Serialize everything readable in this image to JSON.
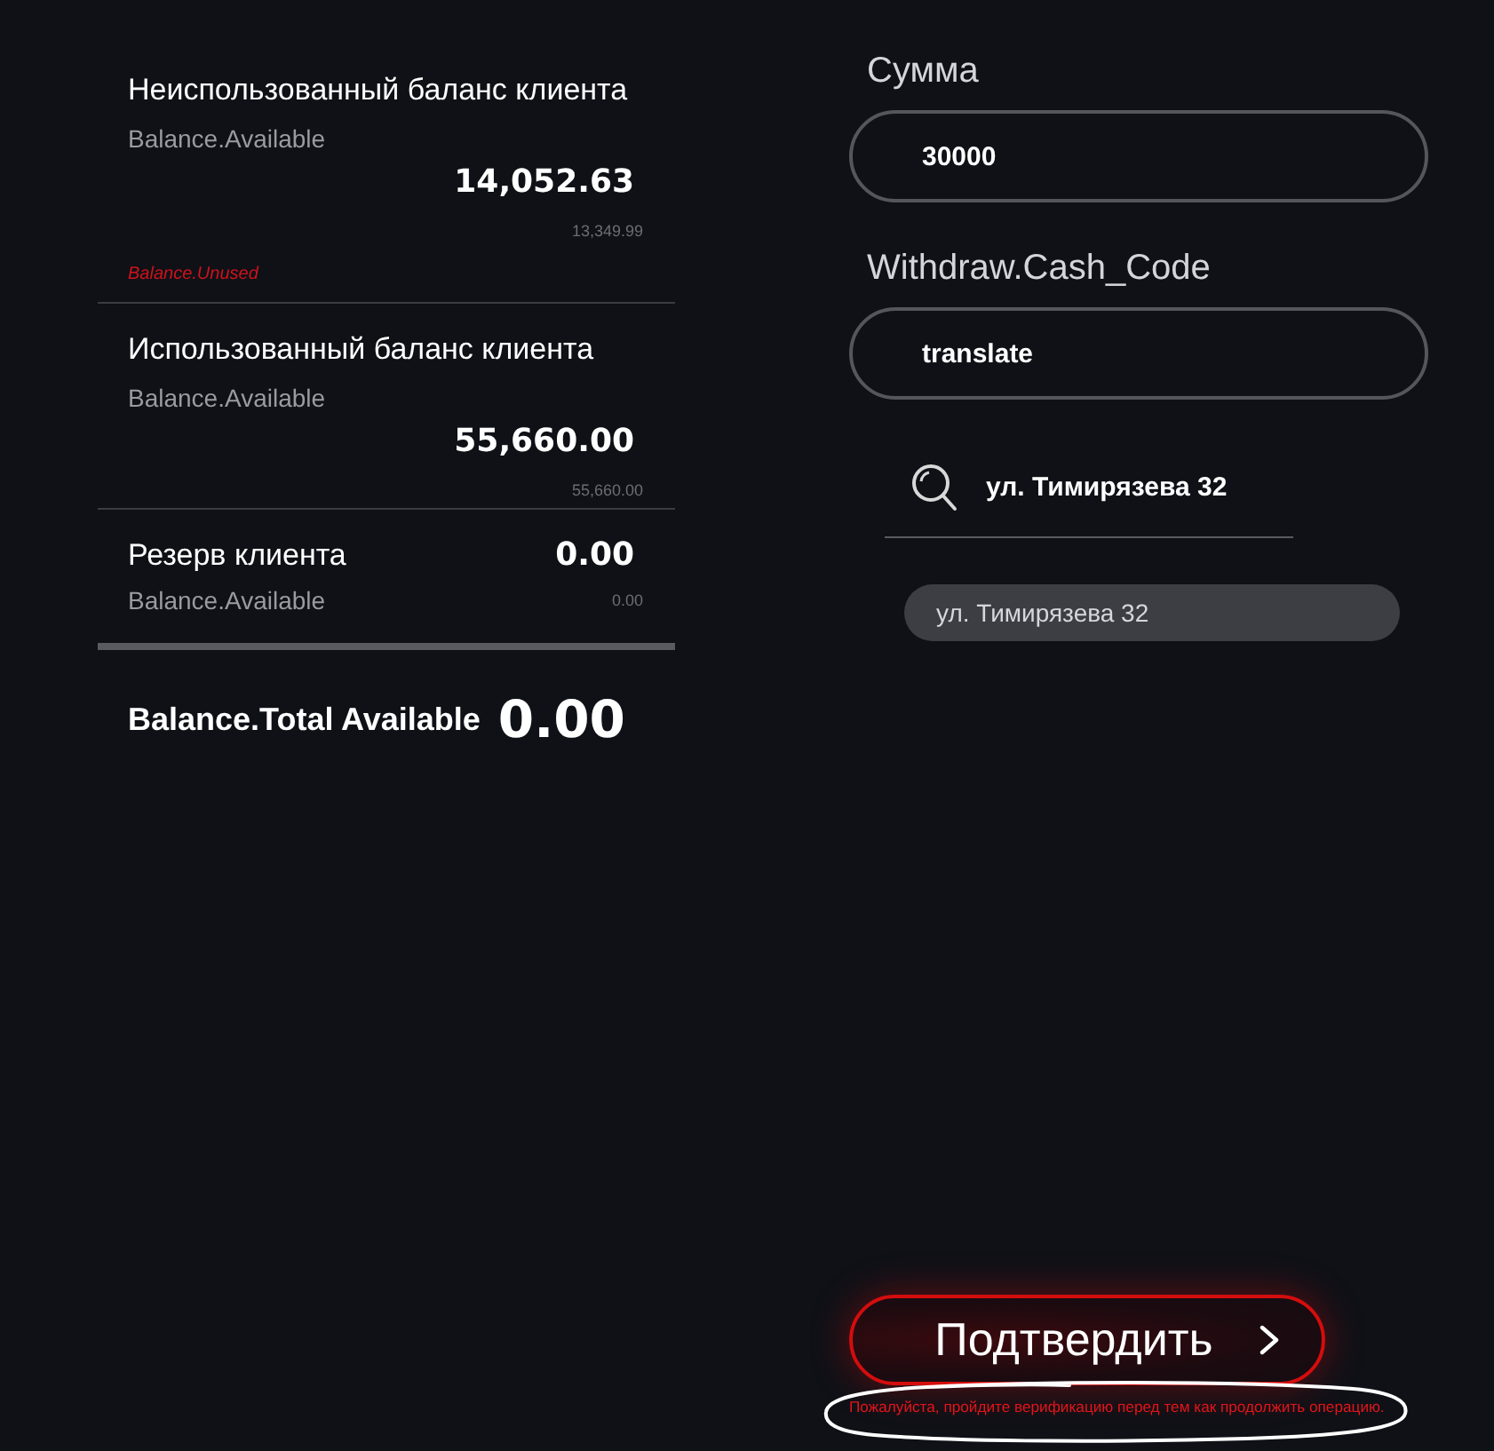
{
  "balances": [
    {
      "kind": "stacked",
      "title": "Неиспользованный баланс клиента",
      "subtitle": "Balance.Available",
      "amount": "14,052.63",
      "secondary_amount": "13,349.99",
      "note": "Balance.Unused"
    },
    {
      "kind": "stacked",
      "title": "Использованный баланс клиента",
      "subtitle": "Balance.Available",
      "amount": "55,660.00",
      "secondary_amount": "55,660.00"
    },
    {
      "kind": "inline",
      "title": "Резерв клиента",
      "subtitle": "Balance.Available",
      "amount": "0.00",
      "secondary_amount": "0.00"
    }
  ],
  "total": {
    "label": "Balance.Total Available",
    "amount": "0.00"
  },
  "form": {
    "fields": [
      {
        "label": "Сумма",
        "value": "30000"
      },
      {
        "label": "Withdraw.Cash_Code",
        "value": "translate"
      }
    ],
    "search": {
      "value": "ул. Тимирязева 32"
    },
    "suggestions": [
      {
        "label": "ул. Тимирязева 32"
      }
    ]
  },
  "confirm_button": {
    "label": "Подтвердить"
  },
  "warning": "Пожалуйста, пройдите верификацию перед тем как продолжить операцию."
}
